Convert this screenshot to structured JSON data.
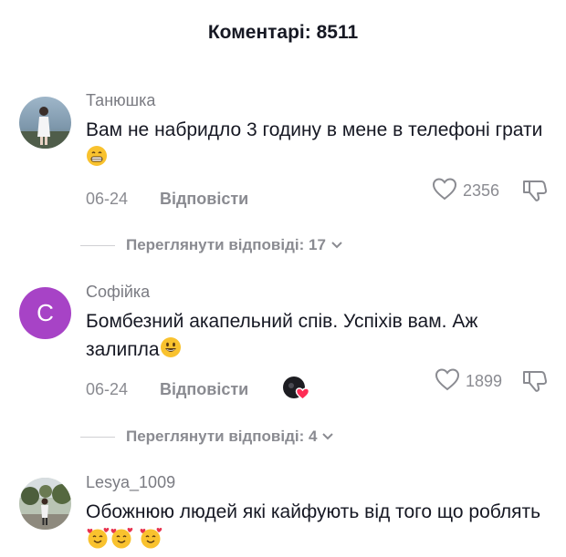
{
  "header": {
    "title": "Коментарі: 8511"
  },
  "comments": [
    {
      "username": "Танюшка",
      "text": "Вам не набридло 3 годину в мене в телефоні грати",
      "date": "06-24",
      "reply_label": "Відповісти",
      "likes": "2356",
      "view_replies": "Переглянути відповіді: 17"
    },
    {
      "username": "Софійка",
      "avatar_letter": "C",
      "text": "Бомбезний акапельний спів. Успіхів вам. Аж залипла",
      "date": "06-24",
      "reply_label": "Відповісти",
      "likes": "1899",
      "view_replies": "Переглянути відповіді: 4"
    },
    {
      "username": "Lesya_1009",
      "text": "Обожнюю людей які кайфують від того що роблять"
    }
  ],
  "colors": {
    "avatar_purple": "#a743c6",
    "muted_text": "#8a8b91",
    "heart_red": "#fe2c55"
  },
  "icons": [
    "heart-outline-icon",
    "dislike-icon",
    "chevron-down-icon",
    "creator-liked-icon"
  ]
}
